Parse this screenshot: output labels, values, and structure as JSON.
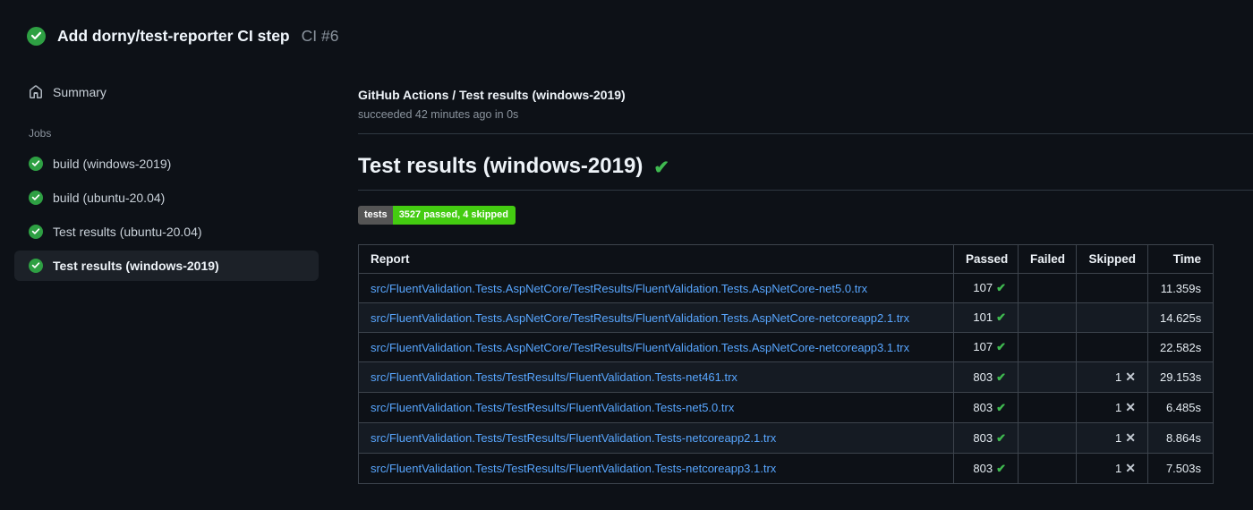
{
  "colors": {
    "page_bg": "#0d1117",
    "accent_link": "#58a6ff",
    "success_green": "#3fb950",
    "status_circle_green": "#2ea043",
    "table_border": "#3d444d",
    "row_alt_bg": "#151b23",
    "selected_item_bg": "#1c2128",
    "muted_text": "#8b949e",
    "badge_label_bg": "#555555",
    "badge_value_bg": "#44cc11"
  },
  "header": {
    "title": "Add dorny/test-reporter CI step",
    "run_number": "CI #6",
    "status_icon": "check-circle-icon"
  },
  "sidebar": {
    "summary_label": "Summary",
    "jobs_label": "Jobs",
    "jobs": [
      {
        "label": "build (windows-2019)",
        "selected": false
      },
      {
        "label": "build (ubuntu-20.04)",
        "selected": false
      },
      {
        "label": "Test results (ubuntu-20.04)",
        "selected": false
      },
      {
        "label": "Test results (windows-2019)",
        "selected": true
      }
    ]
  },
  "run_header": {
    "title": "GitHub Actions / Test results (windows-2019)",
    "status_line": "succeeded 42 minutes ago in 0s"
  },
  "report": {
    "heading": "Test results (windows-2019)",
    "heading_check_glyph": "✔",
    "badge": {
      "label": "tests",
      "value": "3527 passed, 4 skipped"
    },
    "glyphs": {
      "check": "✔",
      "cross": "✕"
    },
    "table": {
      "columns": [
        "Report",
        "Passed",
        "Failed",
        "Skipped",
        "Time"
      ],
      "rows": [
        {
          "report": "src/FluentValidation.Tests.AspNetCore/TestResults/FluentValidation.Tests.AspNetCore-net5.0.trx",
          "passed": "107",
          "failed": "",
          "skipped": "",
          "time": "11.359s"
        },
        {
          "report": "src/FluentValidation.Tests.AspNetCore/TestResults/FluentValidation.Tests.AspNetCore-netcoreapp2.1.trx",
          "passed": "101",
          "failed": "",
          "skipped": "",
          "time": "14.625s"
        },
        {
          "report": "src/FluentValidation.Tests.AspNetCore/TestResults/FluentValidation.Tests.AspNetCore-netcoreapp3.1.trx",
          "passed": "107",
          "failed": "",
          "skipped": "",
          "time": "22.582s"
        },
        {
          "report": "src/FluentValidation.Tests/TestResults/FluentValidation.Tests-net461.trx",
          "passed": "803",
          "failed": "",
          "skipped": "1",
          "time": "29.153s"
        },
        {
          "report": "src/FluentValidation.Tests/TestResults/FluentValidation.Tests-net5.0.trx",
          "passed": "803",
          "failed": "",
          "skipped": "1",
          "time": "6.485s"
        },
        {
          "report": "src/FluentValidation.Tests/TestResults/FluentValidation.Tests-netcoreapp2.1.trx",
          "passed": "803",
          "failed": "",
          "skipped": "1",
          "time": "8.864s"
        },
        {
          "report": "src/FluentValidation.Tests/TestResults/FluentValidation.Tests-netcoreapp3.1.trx",
          "passed": "803",
          "failed": "",
          "skipped": "1",
          "time": "7.503s"
        }
      ]
    }
  }
}
